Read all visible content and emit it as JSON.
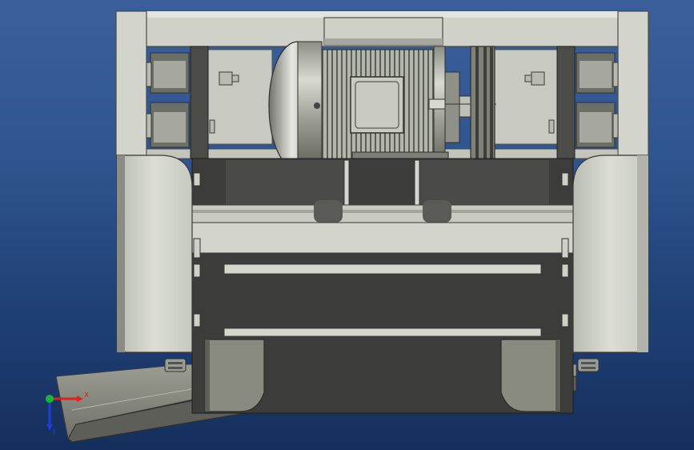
{
  "viewport": {
    "background_top": "#3b5f9a",
    "background_bottom": "#152f5c"
  },
  "model": {
    "frame_color": "#d0d2c9",
    "frame_shadow": "#a9aca2",
    "dark_steel": "#3c3d3b",
    "motor_color": "#a8aa9f"
  },
  "triad": {
    "x_label": "X",
    "y_label": "Y",
    "x_color": "#e0201a",
    "y_color": "#1d3fd8",
    "z_color": "#18b834"
  }
}
